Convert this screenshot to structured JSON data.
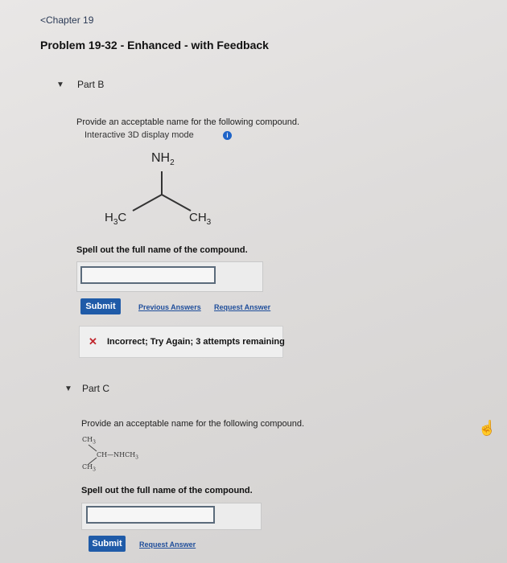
{
  "breadcrumb": {
    "label": "Chapter 19"
  },
  "problem": {
    "title": "Problem 19-32 - Enhanced - with Feedback"
  },
  "part_b": {
    "label": "Part B",
    "prompt": "Provide an acceptable name for the following compound.",
    "display_mode": "Interactive 3D display mode",
    "molecule": {
      "top": "NH",
      "top_sub": "2",
      "left": "H",
      "left_sub": "3",
      "left_end": "C",
      "right": "CH",
      "right_sub": "3"
    },
    "spell_prompt": "Spell out the full name of the compound.",
    "answer_value": "",
    "submit_label": "Submit",
    "previous_answers_label": "Previous Answers",
    "request_answer_label": "Request Answer",
    "feedback_text": "Incorrect; Try Again; 3 attempts remaining"
  },
  "part_c": {
    "label": "Part C",
    "prompt": "Provide an acceptable name for the following compound.",
    "molecule": {
      "top": "CH",
      "top_sub": "3",
      "middle": "CH—NHCH",
      "middle_sub": "3",
      "bottom": "CH",
      "bottom_sub": "3"
    },
    "spell_prompt": "Spell out the full name of the compound.",
    "answer_value": "",
    "submit_label": "Submit",
    "request_answer_label": "Request Answer"
  },
  "icons": {
    "caret": "triangle-down-icon",
    "info": "info-icon",
    "incorrect": "x-mark-icon",
    "cursor": "hand-pointer-icon"
  },
  "colors": {
    "link": "#1f4e9b",
    "submit": "#1f5ba8",
    "error": "#c0262d",
    "info": "#1f64c8"
  }
}
